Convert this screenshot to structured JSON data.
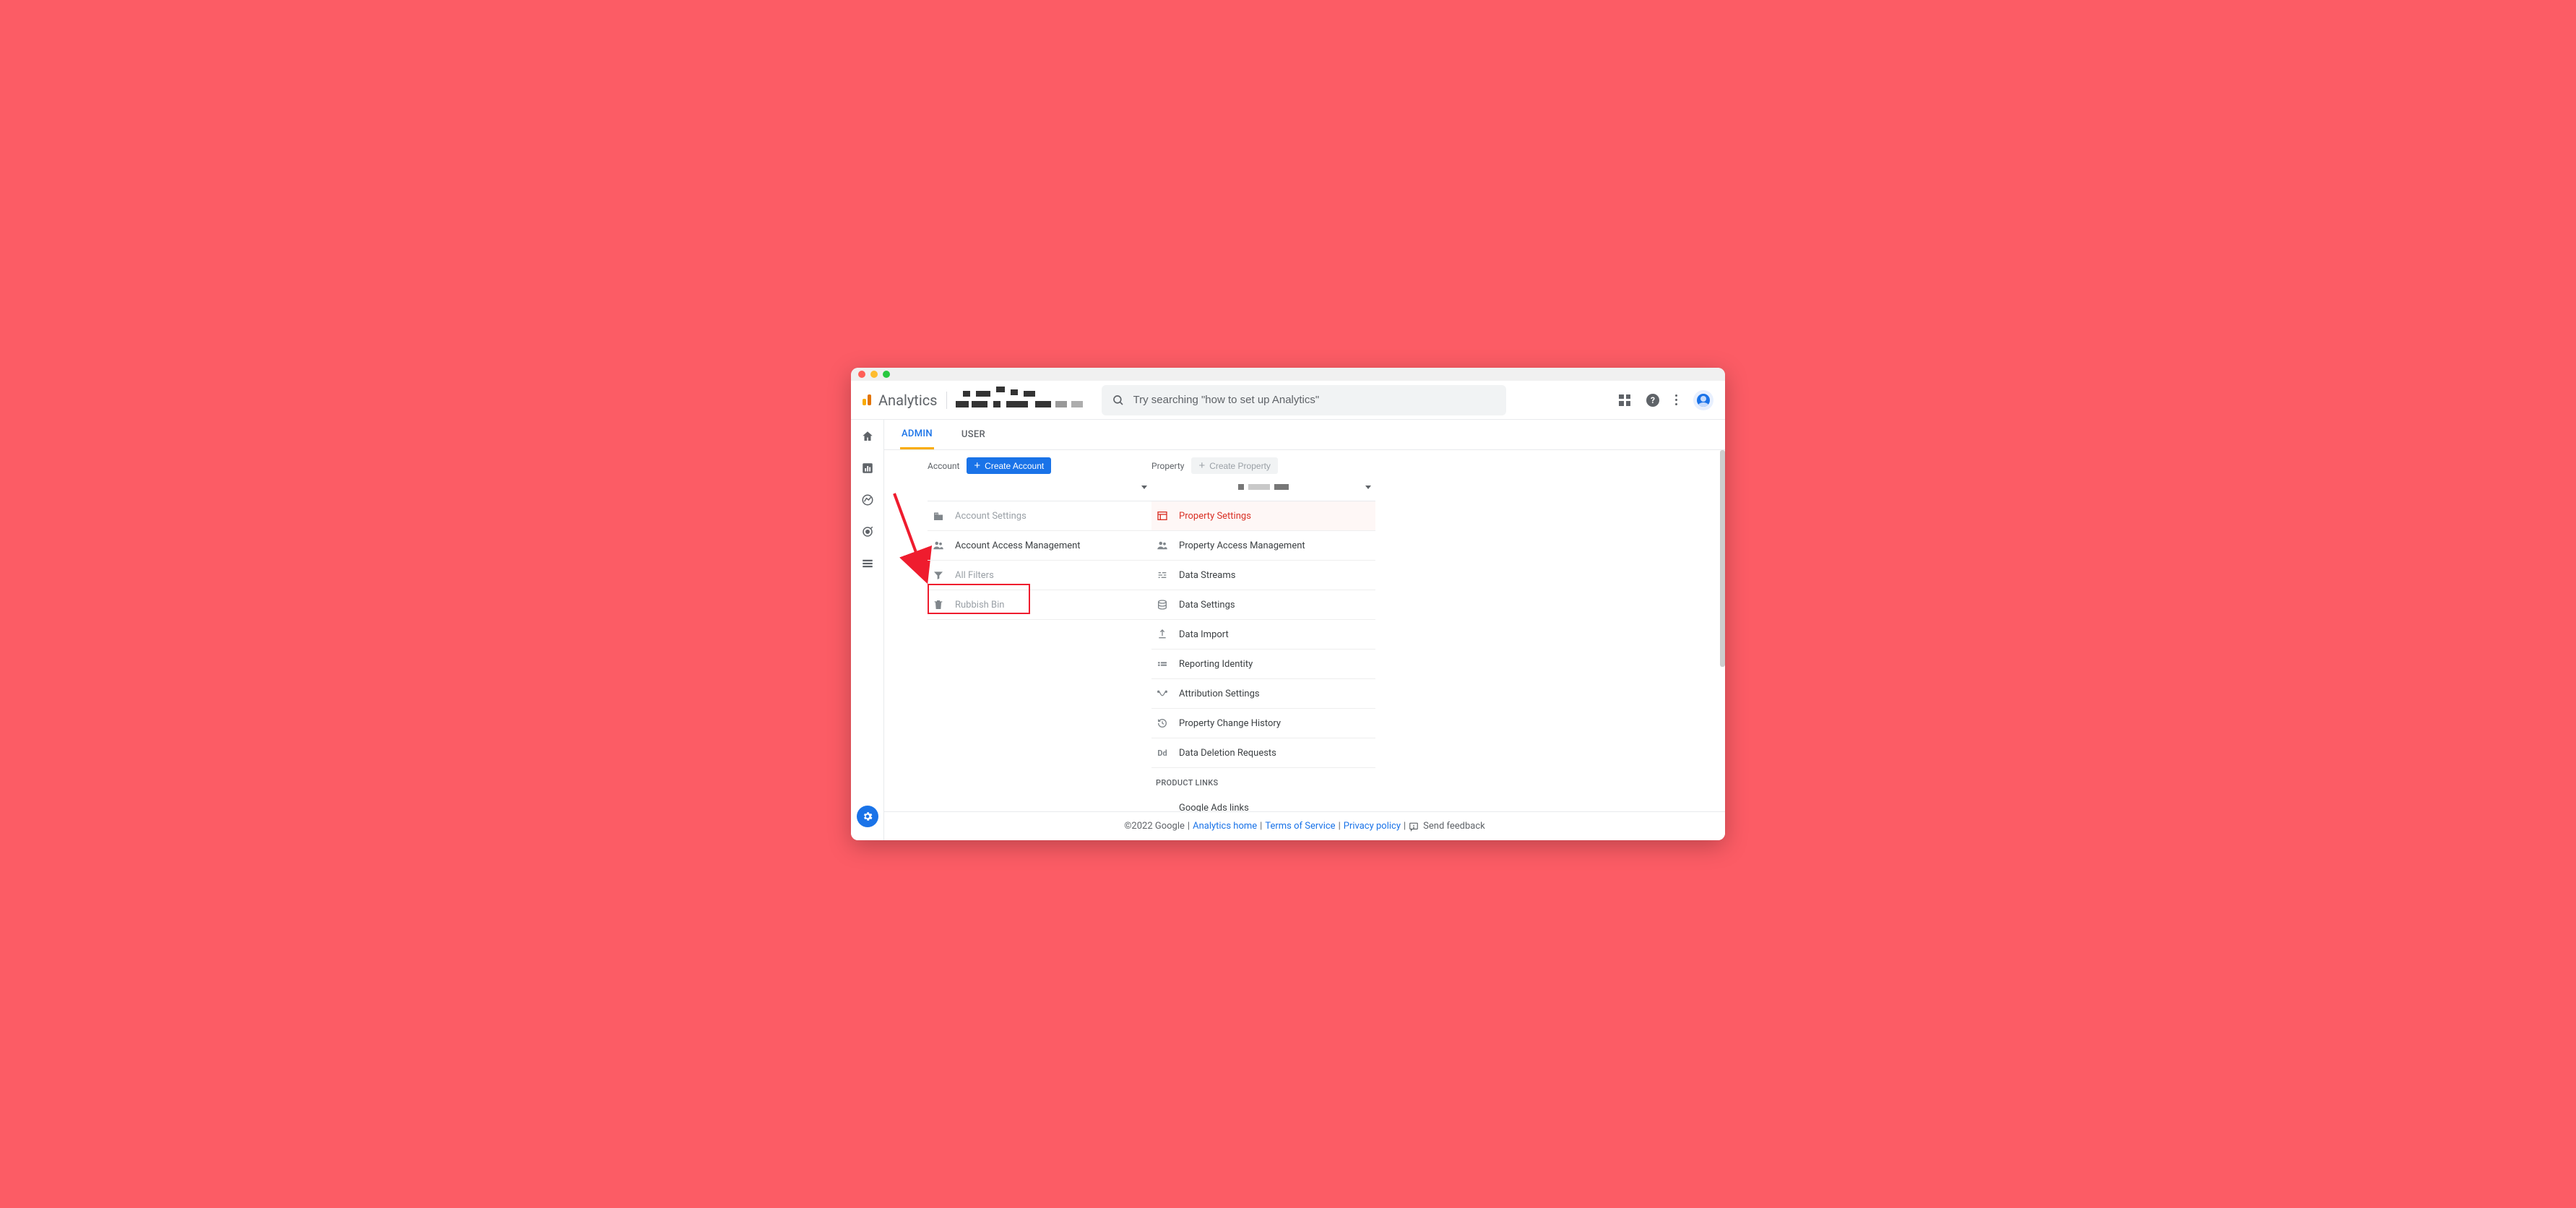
{
  "brand": "Analytics",
  "search": {
    "placeholder": "Try searching \"how to set up Analytics\""
  },
  "tabs": {
    "admin": "ADMIN",
    "user": "USER"
  },
  "account": {
    "label": "Account",
    "create": "Create Account",
    "items": {
      "settings": "Account Settings",
      "access": "Account Access Management",
      "filters": "All Filters",
      "rubbish": "Rubbish Bin"
    }
  },
  "property": {
    "label": "Property",
    "create": "Create Property",
    "items": {
      "settings": "Property Settings",
      "access": "Property Access Management",
      "streams": "Data Streams",
      "data_settings": "Data Settings",
      "import": "Data Import",
      "reporting": "Reporting Identity",
      "attribution": "Attribution Settings",
      "history": "Property Change History",
      "deletion": "Data Deletion Requests",
      "product_links": "PRODUCT LINKS",
      "ads_links": "Google Ads links"
    }
  },
  "footer": {
    "copyright": "©2022 Google",
    "sep": " | ",
    "home": "Analytics home",
    "terms": "Terms of Service",
    "privacy": "Privacy policy",
    "feedback": "Send feedback"
  }
}
